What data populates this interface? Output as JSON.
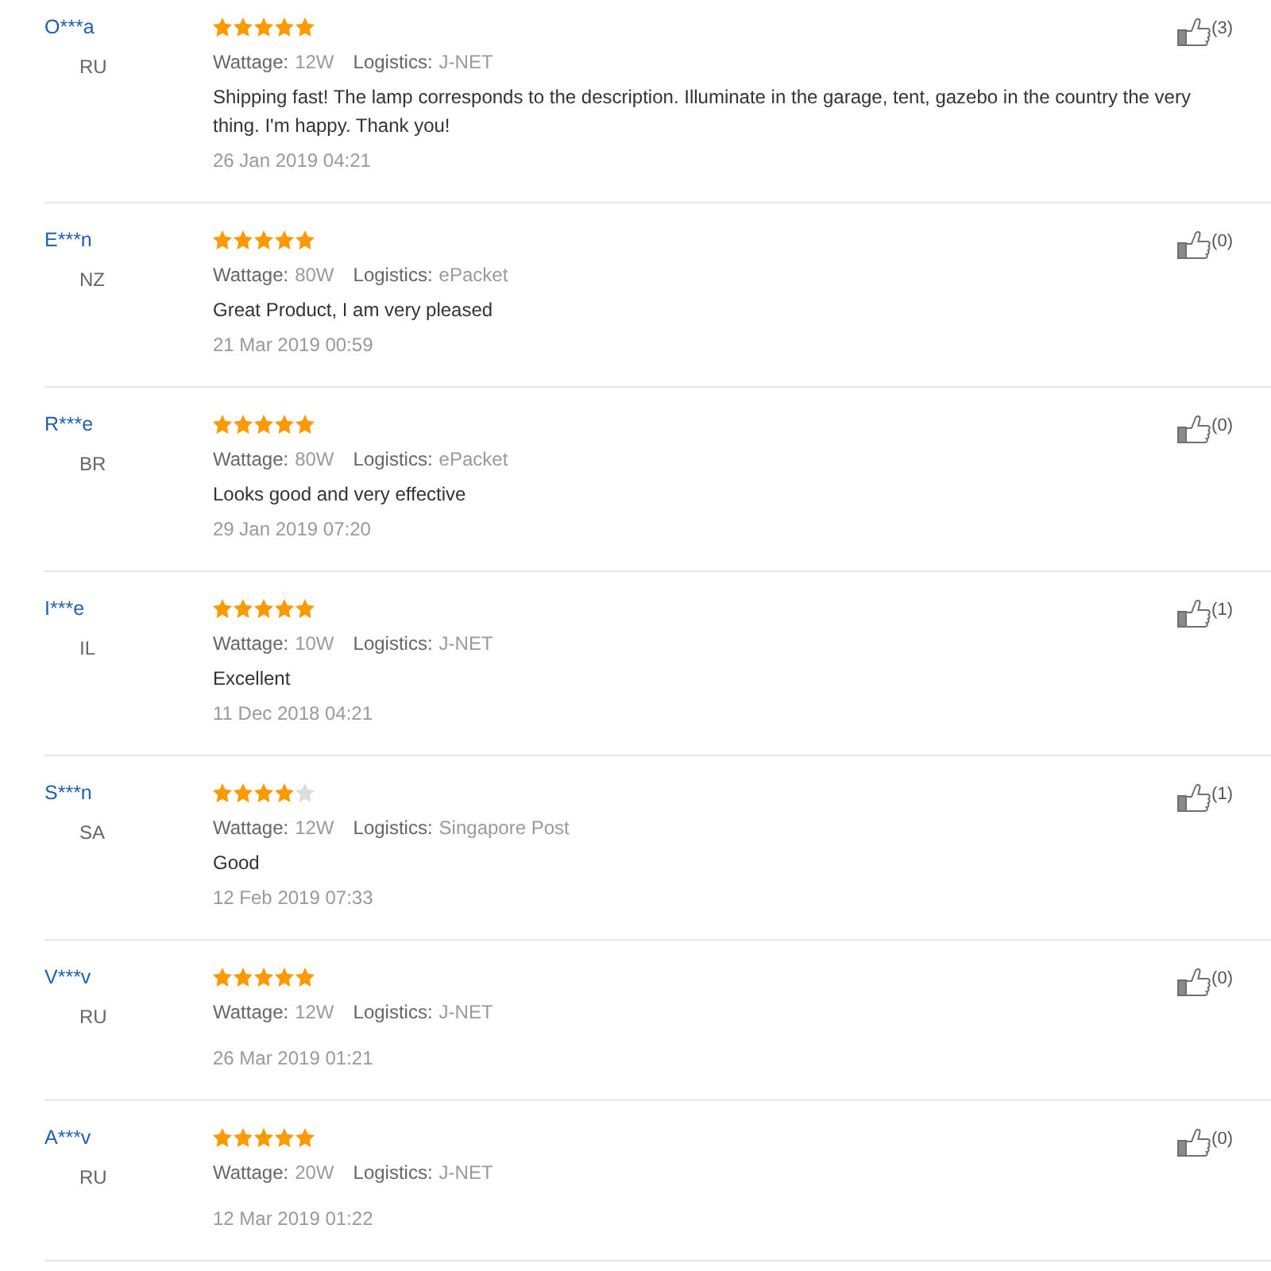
{
  "reviews": [
    {
      "name": "O***a",
      "country": "RU",
      "stars": 5,
      "likes": "(3)",
      "attributes": [
        {
          "label": "Wattage:",
          "value": "12W"
        },
        {
          "label": "Logistics:",
          "value": "J-NET"
        }
      ],
      "comment": "Shipping fast! The lamp corresponds to the description. Illuminate in the garage, tent, gazebo in the country the very thing. I'm happy. Thank you!",
      "date": "26 Jan 2019 04:21"
    },
    {
      "name": "E***n",
      "country": "NZ",
      "stars": 5,
      "likes": "(0)",
      "attributes": [
        {
          "label": "Wattage:",
          "value": "80W"
        },
        {
          "label": "Logistics:",
          "value": "ePacket"
        }
      ],
      "comment": "Great Product, I am very pleased",
      "date": "21 Mar 2019 00:59"
    },
    {
      "name": "R***e",
      "country": "BR",
      "stars": 5,
      "likes": "(0)",
      "attributes": [
        {
          "label": "Wattage:",
          "value": "80W"
        },
        {
          "label": "Logistics:",
          "value": "ePacket"
        }
      ],
      "comment": "Looks good and very effective",
      "date": "29 Jan 2019 07:20"
    },
    {
      "name": "I***e",
      "country": "IL",
      "stars": 5,
      "likes": "(1)",
      "attributes": [
        {
          "label": "Wattage:",
          "value": "10W"
        },
        {
          "label": "Logistics:",
          "value": "J-NET"
        }
      ],
      "comment": "Excellent",
      "date": "11 Dec 2018 04:21"
    },
    {
      "name": "S***n",
      "country": "SA",
      "stars": 4,
      "likes": "(1)",
      "attributes": [
        {
          "label": "Wattage:",
          "value": "12W"
        },
        {
          "label": "Logistics:",
          "value": "Singapore Post"
        }
      ],
      "comment": "Good",
      "date": "12 Feb 2019 07:33"
    },
    {
      "name": "V***v",
      "country": "RU",
      "stars": 5,
      "likes": "(0)",
      "attributes": [
        {
          "label": "Wattage:",
          "value": "12W"
        },
        {
          "label": "Logistics:",
          "value": "J-NET"
        }
      ],
      "date": "26 Mar 2019 01:21"
    },
    {
      "name": "A***v",
      "country": "RU",
      "stars": 5,
      "likes": "(0)",
      "attributes": [
        {
          "label": "Wattage:",
          "value": "20W"
        },
        {
          "label": "Logistics:",
          "value": "J-NET"
        }
      ],
      "date": "12 Mar 2019 01:22"
    }
  ]
}
